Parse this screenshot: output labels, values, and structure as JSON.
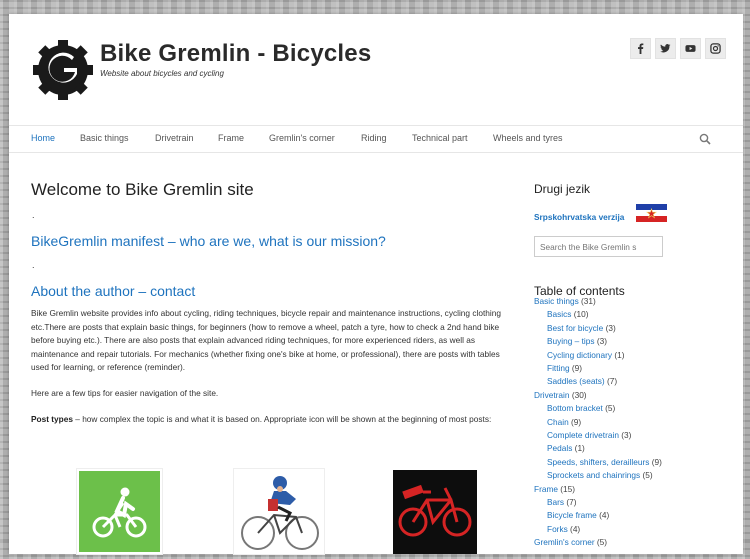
{
  "header": {
    "title": "Bike Gremlin - Bicycles",
    "description": "Website about bicycles and cycling",
    "social": [
      "facebook-icon",
      "twitter-icon",
      "youtube-icon",
      "instagram-icon"
    ]
  },
  "nav": {
    "items": [
      "Home",
      "Basic things",
      "Drivetrain",
      "Frame",
      "Gremlin's corner",
      "Riding",
      "Technical part",
      "Wheels and tyres"
    ],
    "active": "Home"
  },
  "main": {
    "title": "Welcome to Bike Gremlin site",
    "dot": ".",
    "manifest_link": "BikeGremlin manifest – who are we, what is our mission?",
    "about_link": "About the author – contact",
    "intro": "Bike Gremlin website provides info about cycling, riding techniques, bicycle repair and maintenance instructions, cycling clothing etc.There are posts that explain basic things, for beginners (how to remove a wheel, patch a tyre, how to check a 2nd hand bike before buying etc.). There are also posts that explain advanced riding techniques, for more experienced riders, as well as maintenance and repair tutorials. For mechanics (whether fixing one's bike at home, or professional), there are posts with tables used for learning, or reference (reminder).",
    "tips": "Here are a few tips for easier navigation of the site.",
    "post_types_label": "Post types",
    "post_types_text": " – how complex the topic is and what it is based on. Appropriate icon will be shown at the beginning of most posts:"
  },
  "sidebar": {
    "lang_heading": "Drugi jezik",
    "lang_link": "Srpskohrvatska verzija",
    "search_placeholder": "Search the Bike Gremlin s",
    "toc_heading": "Table of contents",
    "toc": [
      {
        "label": "Basic things",
        "count": " (31)",
        "level": 0
      },
      {
        "label": "Basics",
        "count": " (10)",
        "level": 1
      },
      {
        "label": "Best for bicycle",
        "count": " (3)",
        "level": 1
      },
      {
        "label": "Buying – tips",
        "count": " (3)",
        "level": 1
      },
      {
        "label": "Cycling dictionary",
        "count": " (1)",
        "level": 1
      },
      {
        "label": "Fitting",
        "count": " (9)",
        "level": 1
      },
      {
        "label": "Saddles (seats)",
        "count": " (7)",
        "level": 1
      },
      {
        "label": "Drivetrain",
        "count": " (30)",
        "level": 0
      },
      {
        "label": "Bottom bracket",
        "count": " (5)",
        "level": 1
      },
      {
        "label": "Chain",
        "count": " (9)",
        "level": 1
      },
      {
        "label": "Complete drivetrain",
        "count": " (3)",
        "level": 1
      },
      {
        "label": "Pedals",
        "count": " (1)",
        "level": 1
      },
      {
        "label": "Speeds, shifters, derailleurs",
        "count": " (9)",
        "level": 1
      },
      {
        "label": "Sprockets and chainrings",
        "count": " (5)",
        "level": 1
      },
      {
        "label": "Frame",
        "count": " (15)",
        "level": 0
      },
      {
        "label": "Bars",
        "count": " (7)",
        "level": 1
      },
      {
        "label": "Bicycle frame",
        "count": " (4)",
        "level": 1
      },
      {
        "label": "Forks",
        "count": " (4)",
        "level": 1
      },
      {
        "label": "Gremlin's corner",
        "count": " (5)",
        "level": 0
      }
    ]
  },
  "colors": {
    "link": "#1e73be",
    "icon_green": "#6cc04a",
    "icon_dark": "#0d0d0d",
    "icon_red": "#d62424"
  }
}
